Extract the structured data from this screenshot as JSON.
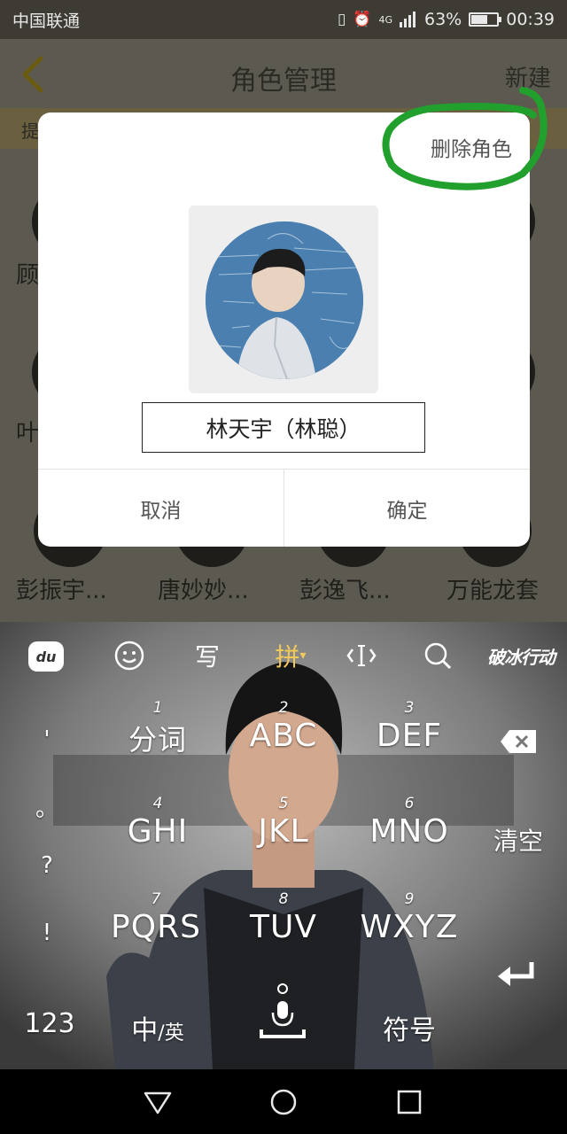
{
  "status_bar": {
    "carrier": "中国联通",
    "network": "4G",
    "battery": "63%",
    "battery_level": 0.63,
    "time": "00:39"
  },
  "app_bar": {
    "title": "角色管理",
    "new_label": "新建",
    "tip_text": "提"
  },
  "background_list": {
    "rows": [
      {
        "names": [
          "顾"
        ]
      },
      {
        "names": [
          "叶"
        ]
      },
      {
        "names": [
          "彭振宇...",
          "唐妙妙...",
          "彭逸飞...",
          "万能龙套"
        ]
      }
    ]
  },
  "dialog": {
    "delete_label": "删除角色",
    "name_value": "林天宇（林聪）",
    "cancel_label": "取消",
    "confirm_label": "确定"
  },
  "keyboard": {
    "toolbar": {
      "du_label": "du",
      "handwrite_label": "写",
      "pinyin_label": "拼",
      "brand_label": "破冰行动"
    },
    "punctuation": [
      "'",
      "。",
      "?",
      "!"
    ],
    "keys": [
      {
        "num": "1",
        "label": "分词"
      },
      {
        "num": "2",
        "label": "ABC"
      },
      {
        "num": "3",
        "label": "DEF"
      },
      {
        "num": "4",
        "label": "GHI"
      },
      {
        "num": "5",
        "label": "JKL"
      },
      {
        "num": "6",
        "label": "MNO"
      },
      {
        "num": "7",
        "label": "PQRS"
      },
      {
        "num": "8",
        "label": "TUV"
      },
      {
        "num": "9",
        "label": "WXYZ"
      }
    ],
    "clear_label": "清空",
    "num_switch_label": "123",
    "lang_switch_main": "中",
    "lang_switch_sub": "/英",
    "symbol_label": "符号"
  },
  "colors": {
    "accent": "#f0c95a",
    "annotation": "#22a02e",
    "dim_overlay": "#5c5a50"
  }
}
